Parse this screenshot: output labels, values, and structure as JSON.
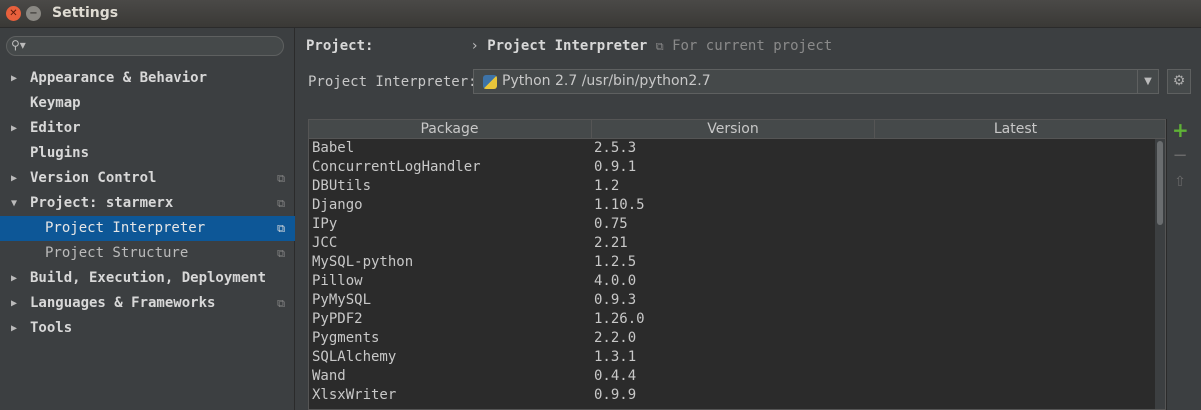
{
  "window": {
    "title": "Settings"
  },
  "sidebar": {
    "search_placeholder": "",
    "items": [
      {
        "label": "Appearance & Behavior",
        "expandable": true,
        "expanded": false,
        "project_icon": false,
        "child": false
      },
      {
        "label": "Keymap",
        "expandable": false,
        "expanded": false,
        "project_icon": false,
        "child": false
      },
      {
        "label": "Editor",
        "expandable": true,
        "expanded": false,
        "project_icon": false,
        "child": false
      },
      {
        "label": "Plugins",
        "expandable": false,
        "expanded": false,
        "project_icon": false,
        "child": false
      },
      {
        "label": "Version Control",
        "expandable": true,
        "expanded": false,
        "project_icon": true,
        "child": false
      },
      {
        "label": "Project: starmerx",
        "expandable": true,
        "expanded": true,
        "project_icon": true,
        "child": false
      },
      {
        "label": "Project Interpreter",
        "expandable": false,
        "expanded": false,
        "project_icon": true,
        "child": true,
        "selected": true
      },
      {
        "label": "Project Structure",
        "expandable": false,
        "expanded": false,
        "project_icon": true,
        "child": true
      },
      {
        "label": "Build, Execution, Deployment",
        "expandable": true,
        "expanded": false,
        "project_icon": false,
        "child": false
      },
      {
        "label": "Languages & Frameworks",
        "expandable": true,
        "expanded": false,
        "project_icon": true,
        "child": false
      },
      {
        "label": "Tools",
        "expandable": true,
        "expanded": false,
        "project_icon": false,
        "child": false
      }
    ]
  },
  "breadcrumb": {
    "project_label": "Project:",
    "separator": "›",
    "page": "Project Interpreter",
    "note": "For current project"
  },
  "interpreter": {
    "label": "Project Interpreter:",
    "value": "Python 2.7 /usr/bin/python2.7"
  },
  "packages": {
    "columns": [
      "Package",
      "Version",
      "Latest"
    ],
    "rows": [
      {
        "package": "Babel",
        "version": "2.5.3",
        "latest": ""
      },
      {
        "package": "ConcurrentLogHandler",
        "version": "0.9.1",
        "latest": ""
      },
      {
        "package": "DBUtils",
        "version": "1.2",
        "latest": ""
      },
      {
        "package": "Django",
        "version": "1.10.5",
        "latest": ""
      },
      {
        "package": "IPy",
        "version": "0.75",
        "latest": ""
      },
      {
        "package": "JCC",
        "version": "2.21",
        "latest": ""
      },
      {
        "package": "MySQL-python",
        "version": "1.2.5",
        "latest": ""
      },
      {
        "package": "Pillow",
        "version": "4.0.0",
        "latest": ""
      },
      {
        "package": "PyMySQL",
        "version": "0.9.3",
        "latest": ""
      },
      {
        "package": "PyPDF2",
        "version": "1.26.0",
        "latest": ""
      },
      {
        "package": "Pygments",
        "version": "2.2.0",
        "latest": ""
      },
      {
        "package": "SQLAlchemy",
        "version": "1.3.1",
        "latest": ""
      },
      {
        "package": "Wand",
        "version": "0.4.4",
        "latest": ""
      },
      {
        "package": "XlsxWriter",
        "version": "0.9.9",
        "latest": ""
      }
    ]
  },
  "toolbar": {
    "add": "+",
    "remove": "−",
    "upgrade": "⇧"
  },
  "icons": {
    "close": "close-icon",
    "minimize": "minimize-icon",
    "search": "search-icon",
    "python": "python-icon",
    "gear": "gear-icon",
    "project": "project-icon"
  },
  "colors": {
    "accent": "#0d5797",
    "add": "#5fb236",
    "background": "#3c3f41",
    "table_bg": "#2b2b2b"
  }
}
